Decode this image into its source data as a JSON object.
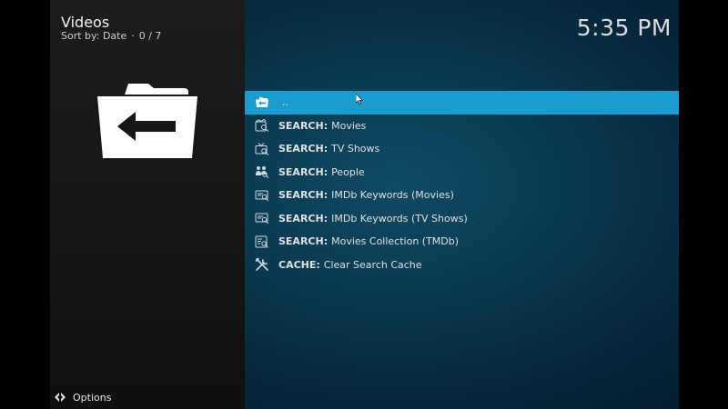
{
  "header": {
    "title": "Videos",
    "sort_label": "Sort by: Date",
    "separator": "·",
    "count": "0 / 7",
    "clock": "5:35 PM"
  },
  "hero": {
    "icon": "folder-back-arrow-icon"
  },
  "list": {
    "items": [
      {
        "icon": "folder-back-icon",
        "prefix": "",
        "label": "..",
        "selected": true
      },
      {
        "icon": "film-search-icon",
        "prefix": "SEARCH:",
        "label": "Movies"
      },
      {
        "icon": "tv-search-icon",
        "prefix": "SEARCH:",
        "label": "TV Shows"
      },
      {
        "icon": "people-search-icon",
        "prefix": "SEARCH:",
        "label": "People"
      },
      {
        "icon": "imdb-search-icon",
        "prefix": "SEARCH:",
        "label": "IMDb Keywords (Movies)"
      },
      {
        "icon": "imdb-search-icon",
        "prefix": "SEARCH:",
        "label": "IMDb Keywords (TV Shows)"
      },
      {
        "icon": "collection-search-icon",
        "prefix": "SEARCH:",
        "label": "Movies Collection (TMDb)"
      },
      {
        "icon": "tools-icon",
        "prefix": "CACHE:",
        "label": "Clear Search Cache"
      }
    ]
  },
  "footer": {
    "options_label": "Options",
    "icon": "options-chevrons-icon"
  },
  "colors": {
    "selection": "#1a9ccf",
    "panel": "#161616",
    "background": "#0a3a52",
    "text": "#e0e0e0"
  }
}
